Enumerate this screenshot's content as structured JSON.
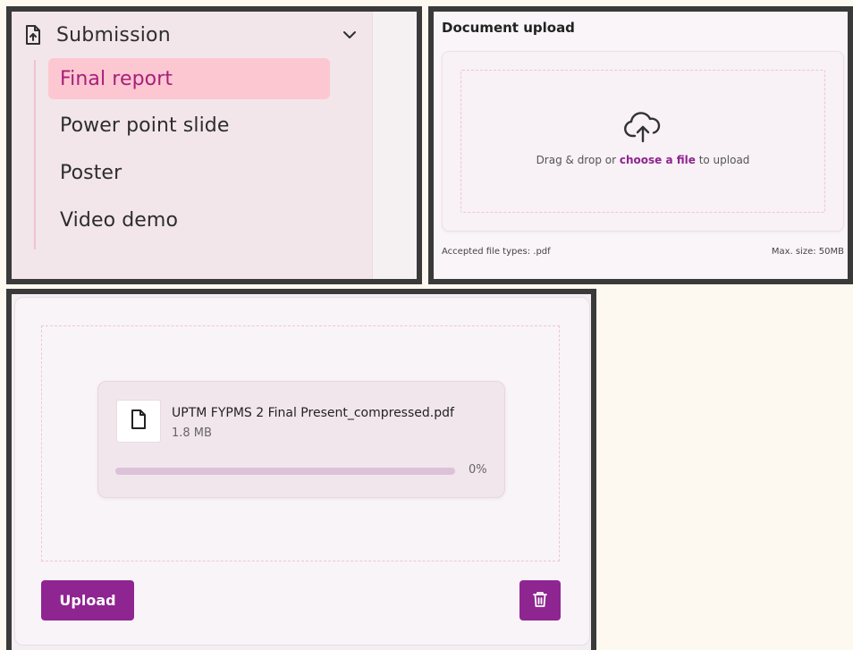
{
  "nav": {
    "section_title": "Submission",
    "items": [
      {
        "label": "Final report",
        "active": true
      },
      {
        "label": "Power point slide",
        "active": false
      },
      {
        "label": "Poster",
        "active": false
      },
      {
        "label": "Video demo",
        "active": false
      }
    ]
  },
  "document_upload": {
    "title": "Document upload",
    "drop_text_prefix": "Drag & drop or ",
    "drop_link": "choose a file",
    "drop_text_suffix": " to upload",
    "accepted_types": "Accepted file types: .pdf",
    "max_size": "Max. size: 50MB"
  },
  "file": {
    "name": "UPTM FYPMS 2 Final Present_compressed.pdf",
    "size": "1.8 MB",
    "progress": 0,
    "progress_label": "0%"
  },
  "actions": {
    "upload_label": "Upload"
  },
  "colors": {
    "accent": "#8e2591",
    "active_item_bg": "#fdc7d1",
    "active_item_text": "#a6207a"
  }
}
